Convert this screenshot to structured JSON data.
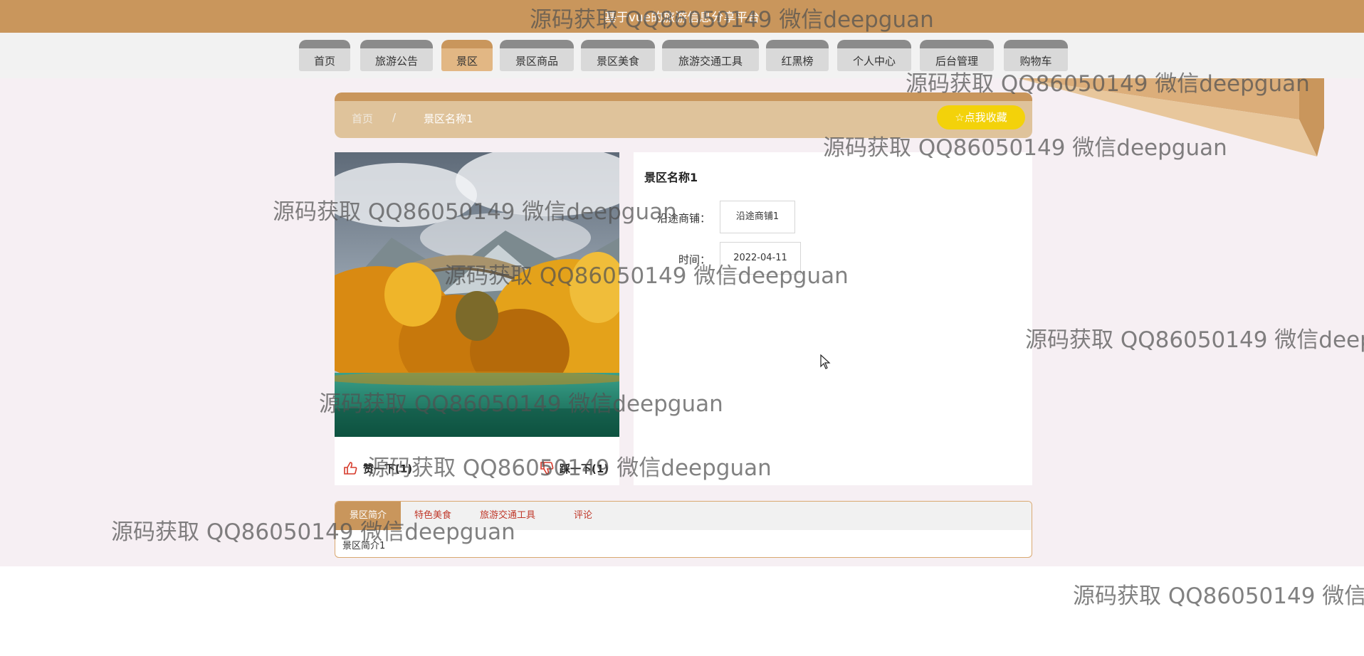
{
  "header": {
    "title": "基于vue的旅游信息分享平台"
  },
  "nav": {
    "items": [
      {
        "label": "首页"
      },
      {
        "label": "旅游公告"
      },
      {
        "label": "景区"
      },
      {
        "label": "景区商品"
      },
      {
        "label": "景区美食"
      },
      {
        "label": "旅游交通工具"
      },
      {
        "label": "红黑榜"
      },
      {
        "label": "个人中心"
      },
      {
        "label": "后台管理"
      },
      {
        "label": "购物车"
      }
    ],
    "active_index": 2
  },
  "breadcrumb": {
    "home": "首页",
    "separator": "/",
    "current": "景区名称1"
  },
  "favorite_button": {
    "label": "☆点我收藏"
  },
  "detail": {
    "name": "景区名称1",
    "fields": [
      {
        "label": "沿途商铺：",
        "value": "沿途商铺1"
      },
      {
        "label": "时间：",
        "value": "2022-04-11"
      }
    ]
  },
  "votes": {
    "up": "赞一下(1)",
    "down": "踩一下(1)"
  },
  "tabs": {
    "items": [
      {
        "label": "景区简介"
      },
      {
        "label": "特色美食"
      },
      {
        "label": "旅游交通工具"
      },
      {
        "label": "评论"
      }
    ],
    "active_content": "景区简介1"
  },
  "watermark": {
    "text": "源码获取 QQ86050149 微信deepguan"
  },
  "colors": {
    "brand": "#c9965c",
    "breadcrumb_bg": "#dfc39b",
    "favorite": "#f3d20a",
    "tab_text": "#c0392b"
  }
}
